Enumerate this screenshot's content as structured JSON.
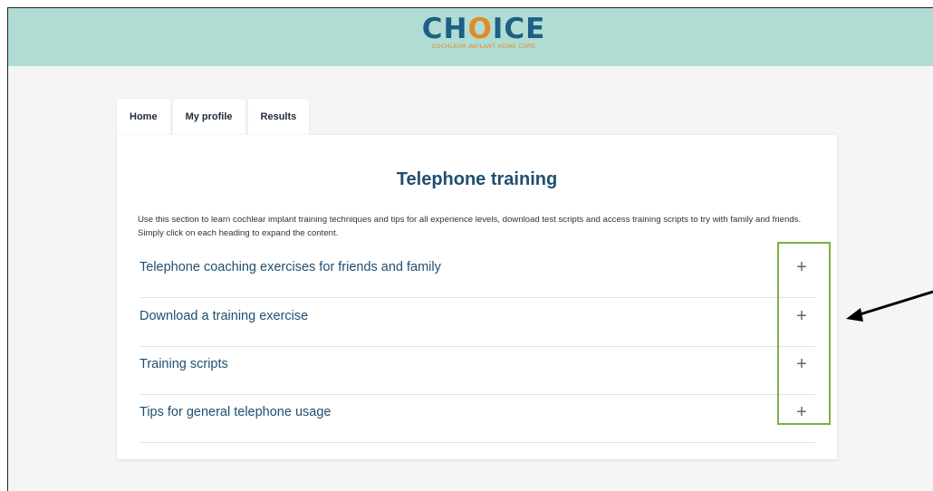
{
  "header": {
    "logo_main": "CH",
    "logo_o": "O",
    "logo_end": "ICE",
    "logo_sub": "COCHLEAR IMPLANT HOME CARE"
  },
  "nav": {
    "tabs": [
      {
        "label": "Home"
      },
      {
        "label": "My profile"
      },
      {
        "label": "Results"
      }
    ]
  },
  "main": {
    "title": "Telephone training",
    "intro": "Use this section to learn cochlear implant training techniques and tips for all experience levels, download test scripts and access training scripts to try with family and friends. Simply click on each heading to expand the content.",
    "sections": [
      {
        "title": "Telephone coaching exercises for friends and family",
        "icon": "+"
      },
      {
        "title": "Download a training exercise",
        "icon": "+"
      },
      {
        "title": "Training scripts",
        "icon": "+"
      },
      {
        "title": "Tips for general telephone usage",
        "icon": "+"
      }
    ]
  },
  "colors": {
    "header_bg": "#b1dcd3",
    "brand_blue": "#1d5f86",
    "brand_orange": "#e08a2a",
    "highlight_green": "#7fb046"
  }
}
